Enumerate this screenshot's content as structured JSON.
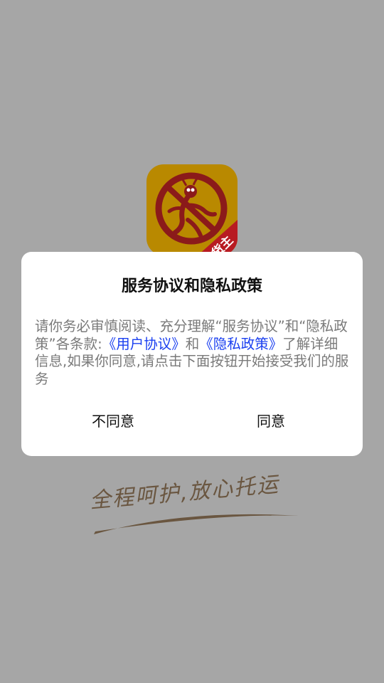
{
  "splash": {
    "icon_name": "delivery-ant-icon",
    "icon_badge": "货主",
    "slogan": "全程呵护,放心托运",
    "colors": {
      "background": "#a6a6a6",
      "icon_bg": "#b98900",
      "icon_ring": "#8b1a1a",
      "badge_bg": "#b81b22",
      "slogan": "#6a5640"
    }
  },
  "dialog": {
    "title": "服务协议和隐私政策",
    "body": {
      "part1": "请你务必审慎阅读、充分理解“服务协议”和“隐私政策”各条款:",
      "link_user_agreement": "《用户协议》",
      "and": "和",
      "link_privacy_policy": "《隐私政策》",
      "part2": "了解详细信息,如果你同意,请点击下面按钮开始接受我们的服务"
    },
    "buttons": {
      "disagree": "不同意",
      "agree": "同意"
    },
    "colors": {
      "link": "#1a3ff0",
      "text": "#7a7a7a"
    }
  }
}
